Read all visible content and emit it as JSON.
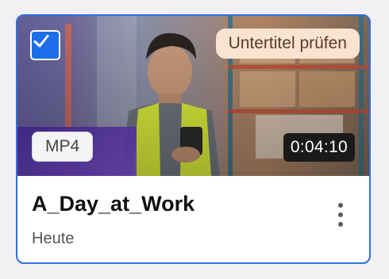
{
  "card": {
    "selected": true,
    "review_badge": "Untertitel prüfen",
    "format_badge": "MP4",
    "duration": "0:04:10",
    "title": "A_Day_at_Work",
    "date": "Heute"
  },
  "icons": {
    "checkbox": "checkmark-icon",
    "menu": "more-vertical-icon"
  },
  "colors": {
    "accent": "#2f6fe4",
    "review_badge_bg": "#fbe3cf"
  }
}
